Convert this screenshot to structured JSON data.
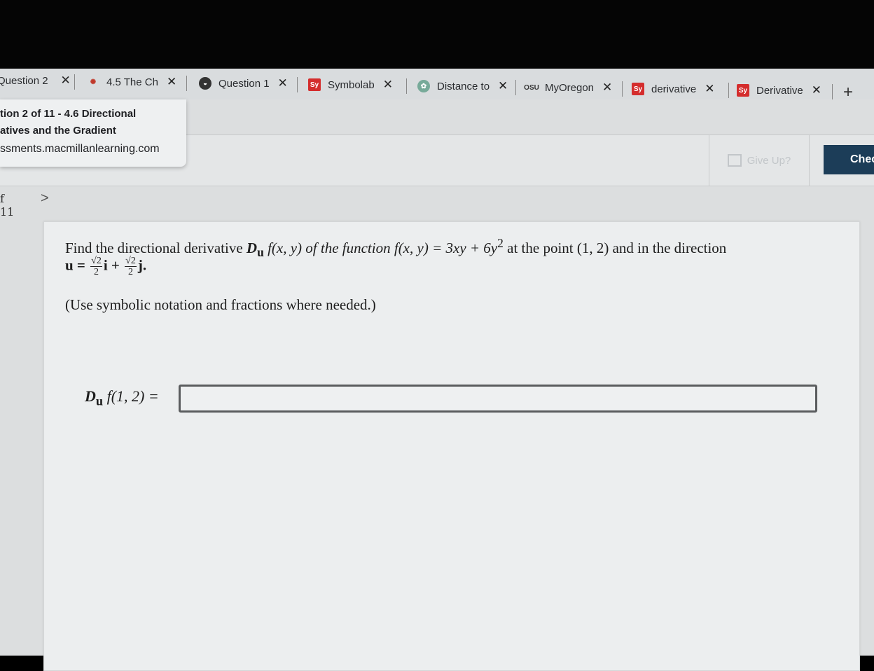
{
  "browser": {
    "tabs": [
      {
        "title": "Question 2",
        "icon": "question-icon"
      },
      {
        "title": "4.5 The Ch",
        "icon": "gear-icon"
      },
      {
        "title": "Question 1",
        "icon": "circle-icon"
      },
      {
        "title": "Symbolab",
        "icon": "symbolab-icon",
        "favicon_text": "Sy"
      },
      {
        "title": "Distance to",
        "icon": "chatgpt-icon"
      },
      {
        "title": "MyOregon",
        "icon": "osu-icon",
        "favicon_text": "OSU"
      },
      {
        "title": "derivative",
        "icon": "symbolab-icon",
        "favicon_text": "Sy"
      },
      {
        "title": "Derivative",
        "icon": "symbolab-icon",
        "favicon_text": "Sy"
      }
    ],
    "close_glyph": "✕",
    "new_tab_glyph": "+"
  },
  "tooltip": {
    "line1": "tion 2 of 11 - 4.6 Directional",
    "line2": "atives and the Gradient",
    "line3": "ssments.macmillanlearning.com"
  },
  "toolbar": {
    "give_up_label": "Give Up?",
    "check_label": "Chec"
  },
  "nav": {
    "count": "f 11",
    "next_glyph": ">"
  },
  "question": {
    "line1_a": "Find the directional derivative ",
    "line1_b": "D",
    "line1_sub": "u",
    "line1_c": " f(x, y) of the function ",
    "line1_d": "f(x, y) = 3xy + 6y",
    "line1_exp": "2",
    "line1_e": " at the point (1, 2) and in the direction",
    "u_label": "u =",
    "frac_num": "√2",
    "frac_den": "2",
    "i_vec": "i +",
    "j_vec": "j.",
    "note": "(Use symbolic notation and fractions where needed.)"
  },
  "answer": {
    "label_d": "D",
    "label_sub": "u",
    "label_rest": " f(1, 2) =",
    "value": ""
  },
  "colors": {
    "check_button": "#1c3d58",
    "symbolab_red": "#d42d2d"
  }
}
